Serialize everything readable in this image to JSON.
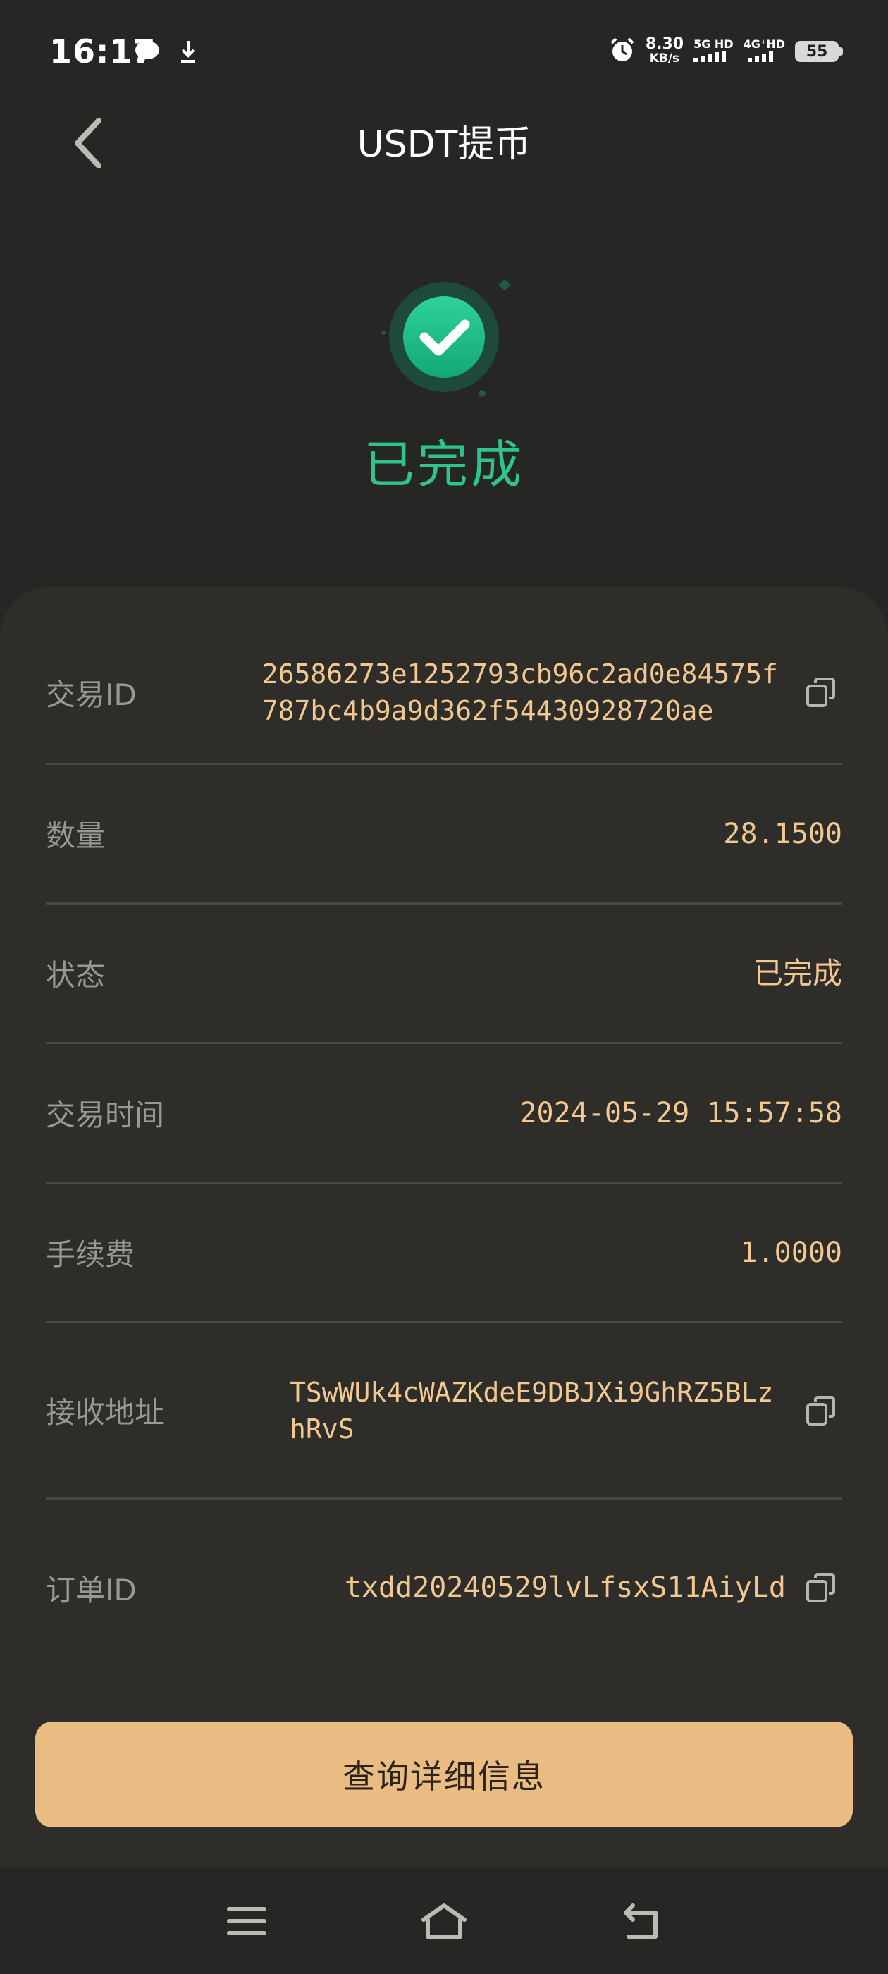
{
  "status_bar": {
    "time": "16:17",
    "net_speed_value": "8.30",
    "net_speed_unit": "KB/s",
    "sig1_label": "5G HD",
    "sig2_label": "4G⁺HD",
    "battery": "55",
    "icons": [
      "chat-bubble-icon",
      "download-icon",
      "alarm-icon",
      "signal-icon",
      "battery-icon"
    ]
  },
  "header": {
    "title": "USDT提币",
    "back_icon": "chevron-left-icon"
  },
  "result": {
    "status_text": "已完成",
    "icon": "check-circle-icon",
    "accent_color": "#2ec48a"
  },
  "details": {
    "tx_id": {
      "label": "交易ID",
      "value": "26586273e1252793cb96c2ad0e84575f787bc4b9a9d362f54430928720ae"
    },
    "amount": {
      "label": "数量",
      "value": "28.1500"
    },
    "status": {
      "label": "状态",
      "value": "已完成"
    },
    "time": {
      "label": "交易时间",
      "value": "2024-05-29 15:57:58"
    },
    "fee": {
      "label": "手续费",
      "value": "1.0000"
    },
    "address": {
      "label": "接收地址",
      "value": "TSwWUk4cWAZKdeE9DBJXi9GhRZ5BLzhRvS"
    },
    "order_id": {
      "label": "订单ID",
      "value": "txdd20240529lvLfsxS11AiyLd"
    }
  },
  "actions": {
    "query_button": "查询详细信息",
    "button_color": "#ebbb84"
  },
  "nav": {
    "icons": [
      "menu-icon",
      "home-icon",
      "back-icon"
    ]
  },
  "colors": {
    "background": "#262625",
    "card": "#2f2d2a",
    "value_text": "#f2c891",
    "label_text": "#9a9893"
  }
}
